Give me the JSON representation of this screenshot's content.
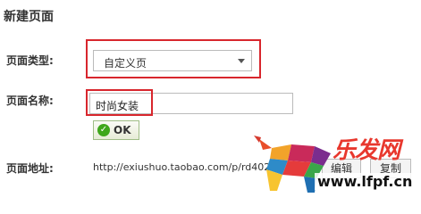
{
  "page": {
    "title": "新建页面"
  },
  "form": {
    "type_label": "页面类型:",
    "type_value": "自定义页",
    "name_label": "页面名称:",
    "name_value": "时尚女装",
    "ok_label": "OK",
    "address_label": "页面地址:",
    "address_value": "http://exiushuo.taobao.com/p/rd402",
    "edit_label": "编辑",
    "copy_label": "复制"
  },
  "watermark": {
    "text": "乐发网",
    "url": "www.lfpf.cn"
  },
  "colors": {
    "highlight": "#d8262d",
    "ok_check": "#3ea71b"
  },
  "icons": {
    "ok": "check-circle-icon",
    "select": "chevron-down-icon"
  }
}
